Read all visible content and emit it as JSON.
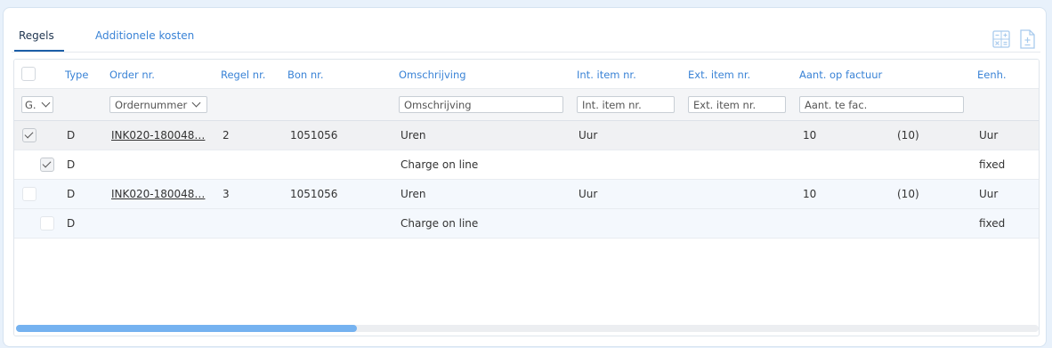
{
  "tabs": [
    {
      "label": "Regels",
      "active": true
    },
    {
      "label": "Additionele kosten",
      "active": false
    }
  ],
  "toolbar": {
    "icons": [
      "calculator-icon",
      "document-plus-minus-icon"
    ]
  },
  "columns": {
    "type": "Type",
    "order_nr": "Order nr.",
    "regel_nr": "Regel nr.",
    "bon_nr": "Bon nr.",
    "omschrijving": "Omschrijving",
    "int_item_nr": "Int. item nr.",
    "ext_item_nr": "Ext. item nr.",
    "aant_op_factuur": "Aant. op factuur",
    "eenh": "Eenh."
  },
  "filters": {
    "group_select": "G.",
    "order_select": "Ordernummer",
    "omschrijving": "Omschrijving",
    "int_item_nr": "Int. item nr.",
    "ext_item_nr": "Ext. item nr.",
    "aant_te_fac": "Aant. te fac."
  },
  "rows": [
    {
      "checked": true,
      "type": "D",
      "order_nr": "INK020-180048…",
      "regel_nr": "2",
      "bon_nr": "1051056",
      "omschrijving": "Uren",
      "int_item_nr": "Uur",
      "aantal": "10",
      "aantal_paren": "(10)",
      "eenh": "Uur"
    },
    {
      "checked": true,
      "type": "D",
      "order_nr": "",
      "regel_nr": "",
      "bon_nr": "",
      "omschrijving": "Charge on line",
      "int_item_nr": "",
      "aantal": "",
      "aantal_paren": "",
      "eenh": "fixed"
    },
    {
      "checked": false,
      "type": "D",
      "order_nr": "INK020-180048…",
      "regel_nr": "3",
      "bon_nr": "1051056",
      "omschrijving": "Uren",
      "int_item_nr": "Uur",
      "aantal": "10",
      "aantal_paren": "(10)",
      "eenh": "Uur"
    },
    {
      "checked": false,
      "type": "D",
      "order_nr": "",
      "regel_nr": "",
      "bon_nr": "",
      "omschrijving": "Charge on line",
      "int_item_nr": "",
      "aantal": "",
      "aantal_paren": "",
      "eenh": "fixed"
    }
  ],
  "scrollbar": {
    "position_fraction": 0.0,
    "visible_fraction": 0.33
  },
  "colors": {
    "accent": "#3a83d6",
    "selected_row": "#f0f1f3",
    "alt_row": "#f4f8fd",
    "scroll_thumb": "#75b2f0"
  }
}
